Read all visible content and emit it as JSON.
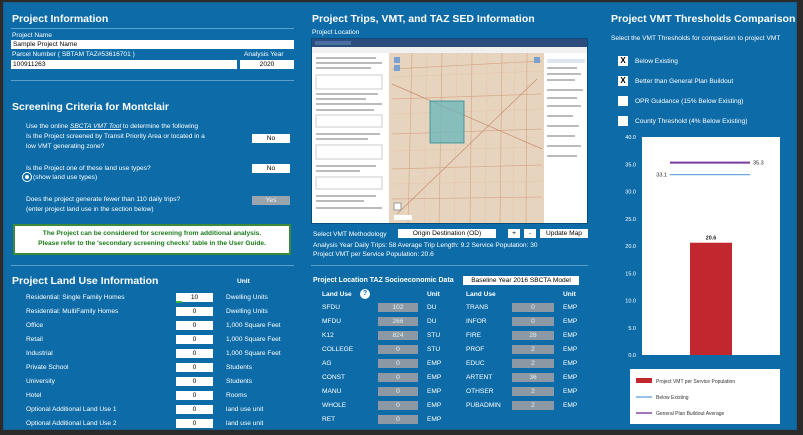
{
  "project_info": {
    "title": "Project Information",
    "name_label": "Project Name",
    "name_value": "Sample Project Name",
    "parcel_label": "Parcel Number ( SBTAM TAZ#53616701 )",
    "year_label": "Analysis Year",
    "parcel_value": "100911263",
    "year_value": "2020"
  },
  "screening": {
    "title": "Screening Criteria for Montclair",
    "q1_prefix": "Use the online ",
    "q1_link": "SBCTA VMT Tool",
    "q1_suffix": " to determine the following",
    "q1_line2": "Is the Project screened by Transit Priority Area or located in a",
    "q1_line3": "low VMT generating zone?",
    "q1_answer": "No",
    "q2_line1": "Is the Project one of these land use types?",
    "q2_show": "(show land use types)",
    "q2_answer": "No",
    "q3_line1": "Does the project generate fewer than 110 daily trips?",
    "q3_line2": "(enter project land use in the section below)",
    "q3_answer": "Yes",
    "warning_line1": "The Project can be considered for screening from additional analysis.",
    "warning_line2": "Please refer to the 'secondary screening checks' table in the User Guide."
  },
  "land_use": {
    "title": "Project Land Use Information",
    "unit_header": "Unit",
    "rows": [
      {
        "name": "Residential:  Single Family Homes",
        "value": "10",
        "unit": "Dwelling Units"
      },
      {
        "name": "Residential:  MultiFamily Homes",
        "value": "0",
        "unit": "Dwelling Units"
      },
      {
        "name": "Office",
        "value": "0",
        "unit": "1,000 Square Feet"
      },
      {
        "name": "Retail",
        "value": "0",
        "unit": "1,000 Square Feet"
      },
      {
        "name": "Industrial",
        "value": "0",
        "unit": "1,000 Square Feet"
      },
      {
        "name": "Private School",
        "value": "0",
        "unit": "Students"
      },
      {
        "name": "University",
        "value": "0",
        "unit": "Students"
      },
      {
        "name": "Hotel",
        "value": "0",
        "unit": "Rooms"
      },
      {
        "name": "Optional Additional Land Use 1",
        "value": "0",
        "unit": "land use unit"
      },
      {
        "name": "Optional Additional Land Use 2",
        "value": "0",
        "unit": "land use unit"
      }
    ]
  },
  "trips": {
    "title": "Project Trips, VMT, and TAZ SED Information",
    "location_label": "Project Location",
    "map_header_title": "SBCTA VMT Screening Tool",
    "methodology_label": "Select VMT Methodology",
    "methodology_value": "Origin Destination (OD)",
    "plus": "+",
    "minus": "-",
    "update_map": "Update Map",
    "stats_line1": "Analysis Year Daily Trips: 58    Average Trip Length: 9.2    Service Population: 30",
    "stats_line2": "Project VMT per Service Population: 20.6"
  },
  "taz": {
    "title": "Project Location TAZ Socioeconomic Data",
    "baseline": "Baseline Year 2016 SBCTA Model",
    "land_use_header": "Land Use",
    "help_icon": "?",
    "unit_header": "Unit",
    "left": [
      {
        "name": "SFDU",
        "value": "102",
        "unit": "DU"
      },
      {
        "name": "MFDU",
        "value": "266",
        "unit": "DU"
      },
      {
        "name": "K12",
        "value": "824",
        "unit": "STU"
      },
      {
        "name": "COLLEGE",
        "value": "0",
        "unit": "STU"
      },
      {
        "name": "AG",
        "value": "0",
        "unit": "EMP"
      },
      {
        "name": "CONST",
        "value": "0",
        "unit": "EMP"
      },
      {
        "name": "MANU",
        "value": "0",
        "unit": "EMP"
      },
      {
        "name": "WHOLE",
        "value": "0",
        "unit": "EMP"
      },
      {
        "name": "RET",
        "value": "0",
        "unit": "EMP"
      }
    ],
    "right": [
      {
        "name": "TRANS",
        "value": "0",
        "unit": "EMP"
      },
      {
        "name": "INFOR",
        "value": "0",
        "unit": "EMP"
      },
      {
        "name": "FIRE",
        "value": "28",
        "unit": "EMP"
      },
      {
        "name": "PROF",
        "value": "2",
        "unit": "EMP"
      },
      {
        "name": "EDUC",
        "value": "2",
        "unit": "EMP"
      },
      {
        "name": "ARTENT",
        "value": "36",
        "unit": "EMP"
      },
      {
        "name": "OTHSER",
        "value": "2",
        "unit": "EMP"
      },
      {
        "name": "PUBADMIN",
        "value": "2",
        "unit": "EMP"
      }
    ]
  },
  "thresholds": {
    "title": "Project VMT Thresholds Comparison",
    "subtitle": "Select the VMT Thresholds for comparison to project VMT",
    "options": [
      {
        "label": "Below Existing",
        "checked": true,
        "mark": "X"
      },
      {
        "label": "Better than General Plan Buildout",
        "checked": true,
        "mark": "X"
      },
      {
        "label": "OPR Guidance (15% Below Existing)",
        "checked": false,
        "mark": ""
      },
      {
        "label": "County Threshold (4% Below Existing)",
        "checked": false,
        "mark": ""
      }
    ]
  },
  "chart_data": {
    "type": "bar",
    "ylim": [
      0,
      40
    ],
    "yticks": [
      "40.0",
      "35.0",
      "30.0",
      "25.0",
      "20.0",
      "15.0",
      "10.0",
      "5.0",
      "0.0"
    ],
    "bar_value": 20.6,
    "bar_label": "20.6",
    "bar_color": "#c0282d",
    "lines": [
      {
        "name": "General Plan Buildout Average",
        "value": 35.3,
        "label": "35.3",
        "color": "#7a3aa0"
      },
      {
        "name": "Below Existing",
        "value": 33.1,
        "label": "33.1",
        "color": "#6fa8dc"
      }
    ],
    "legend": [
      {
        "label": "Project VMT per Service Population",
        "color": "#c0282d",
        "kind": "box"
      },
      {
        "label": "Below Existing",
        "color": "#6fa8dc",
        "kind": "line"
      },
      {
        "label": "General Plan Buildout Average",
        "color": "#7a3aa0",
        "kind": "line"
      }
    ]
  }
}
